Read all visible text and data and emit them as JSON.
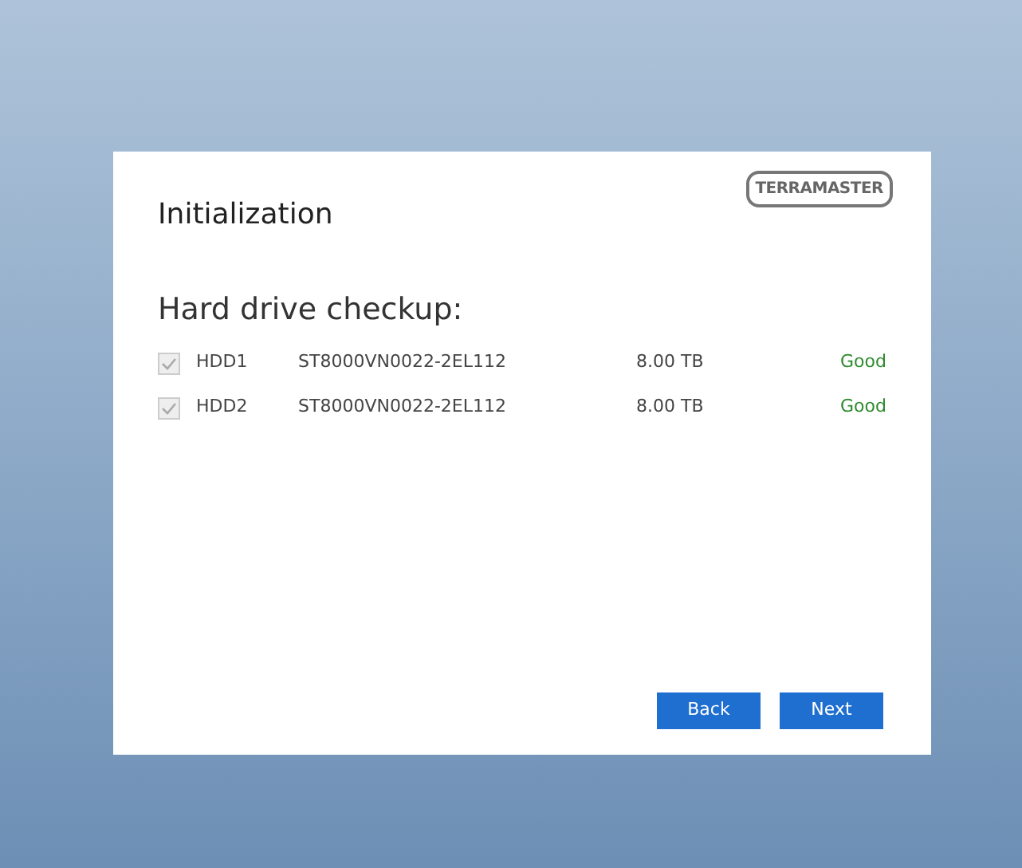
{
  "dialog": {
    "title": "Initialization",
    "logo": "TERRAMASTER",
    "heading": "Hard drive checkup:",
    "drives": [
      {
        "checked": true,
        "disabled": true,
        "name": "HDD1",
        "model": "ST8000VN0022-2EL112",
        "capacity": "8.00 TB",
        "status": "Good",
        "color": "#2e8b2e"
      },
      {
        "checked": true,
        "disabled": true,
        "name": "HDD2",
        "model": "ST8000VN0022-2EL112",
        "capacity": "8.00 TB",
        "status": "Good",
        "color": "#2e8b2e"
      }
    ],
    "buttons": [
      "Back",
      "Next"
    ]
  }
}
